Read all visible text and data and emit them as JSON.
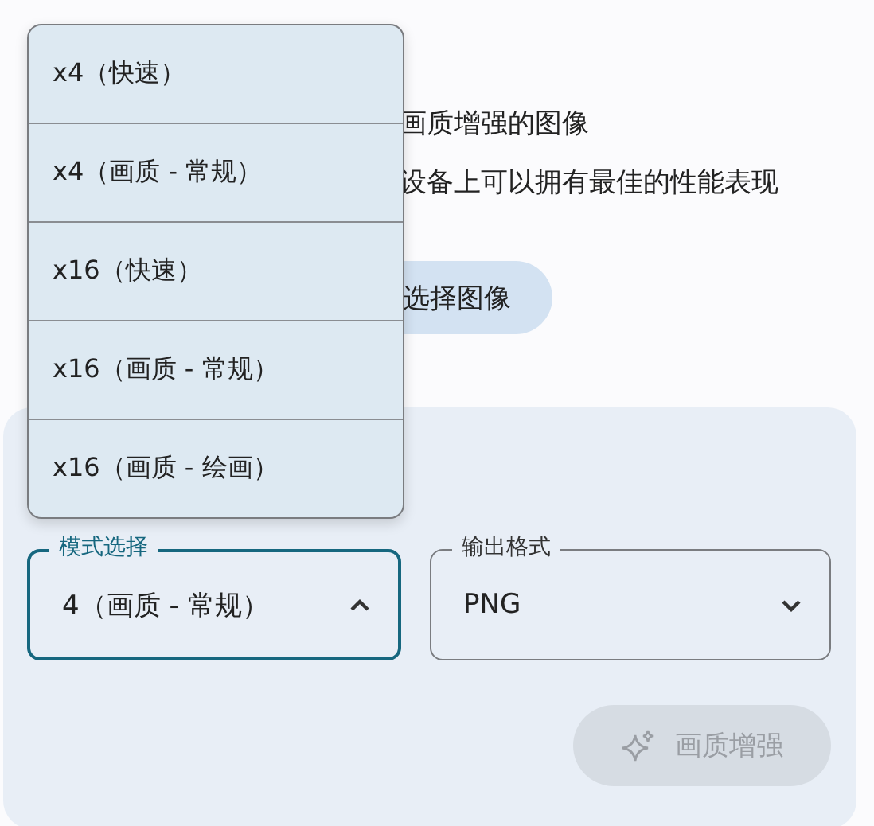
{
  "description": [
    "画质增强的图像",
    "设备上可以拥有最佳的性能表现"
  ],
  "select_image_button": {
    "label": "选择图像"
  },
  "mode_select": {
    "label": "模式选择",
    "value": "4（画质 - 常规）",
    "expanded": true,
    "options": [
      {
        "label": "x4（快速）"
      },
      {
        "label": "x4（画质 - 常规）"
      },
      {
        "label": "x16（快速）"
      },
      {
        "label": "x16（画质 - 常规）"
      },
      {
        "label": "x16（画质 - 绘画）"
      }
    ]
  },
  "output_format": {
    "label": "输出格式",
    "value": "PNG",
    "expanded": false
  },
  "enhance_button": {
    "label": "画质增强",
    "disabled": true
  }
}
